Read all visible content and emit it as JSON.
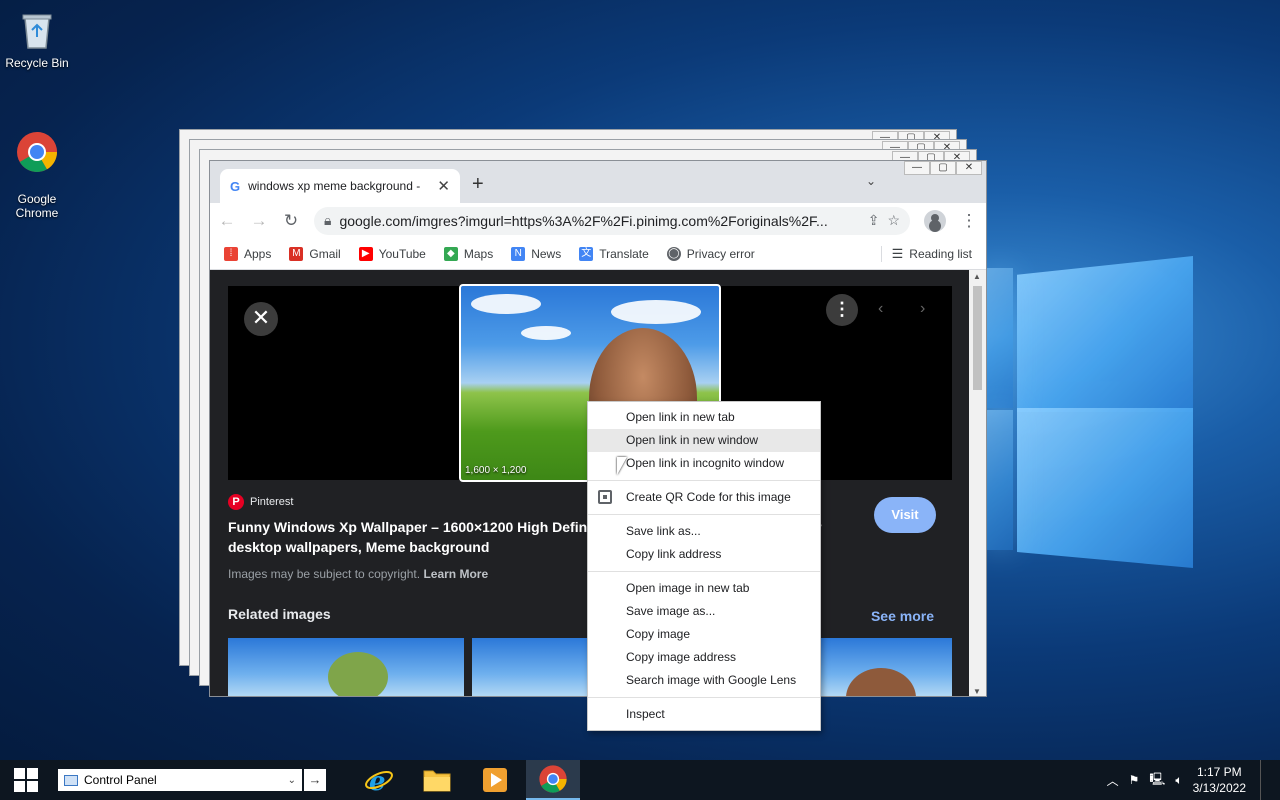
{
  "desktop": {
    "icons": [
      {
        "label": "Recycle Bin"
      },
      {
        "label": "Google\nChrome"
      }
    ]
  },
  "browser": {
    "tab": {
      "title": "windows xp meme background -"
    },
    "omnibox": {
      "url": "google.com/imgres?imgurl=https%3A%2F%2Fi.pinimg.com%2Foriginals%2F..."
    },
    "bookmarks": [
      {
        "label": "Apps",
        "icon": "apps-grid-icon",
        "color": "#ea4335"
      },
      {
        "label": "Gmail",
        "icon": "gmail-icon",
        "color": "#d93025"
      },
      {
        "label": "YouTube",
        "icon": "youtube-icon",
        "color": "#ff0000"
      },
      {
        "label": "Maps",
        "icon": "maps-icon",
        "color": "#34a853"
      },
      {
        "label": "News",
        "icon": "news-icon",
        "color": "#4285f4"
      },
      {
        "label": "Translate",
        "icon": "translate-icon",
        "color": "#4285f4"
      },
      {
        "label": "Privacy error",
        "icon": "globe-icon",
        "color": "#5f6368"
      }
    ],
    "reading_list": "Reading list",
    "viewer": {
      "image_size": "1,600 × 1,200",
      "source": "Pinterest",
      "title": "Funny Windows Xp Wallpaper – 1600×1200 High Definition Wallpapers | Laptop wallpaper desktop wallpapers, Meme background",
      "copyright": "Images may be subject to copyright.",
      "learn_more": "Learn More",
      "visit": "Visit",
      "related": "Related images",
      "see_more": "See more"
    }
  },
  "context_menu": {
    "group1": [
      "Open link in new tab",
      "Open link in new window",
      "Open link in incognito window"
    ],
    "qr": "Create QR Code for this image",
    "group2": [
      "Save link as...",
      "Copy link address"
    ],
    "group3": [
      "Open image in new tab",
      "Save image as...",
      "Copy image",
      "Copy image address",
      "Search image with Google Lens"
    ],
    "inspect": "Inspect",
    "hovered_index": 1
  },
  "taskbar": {
    "address": "Control Panel",
    "time": "1:17 PM",
    "date": "3/13/2022"
  }
}
